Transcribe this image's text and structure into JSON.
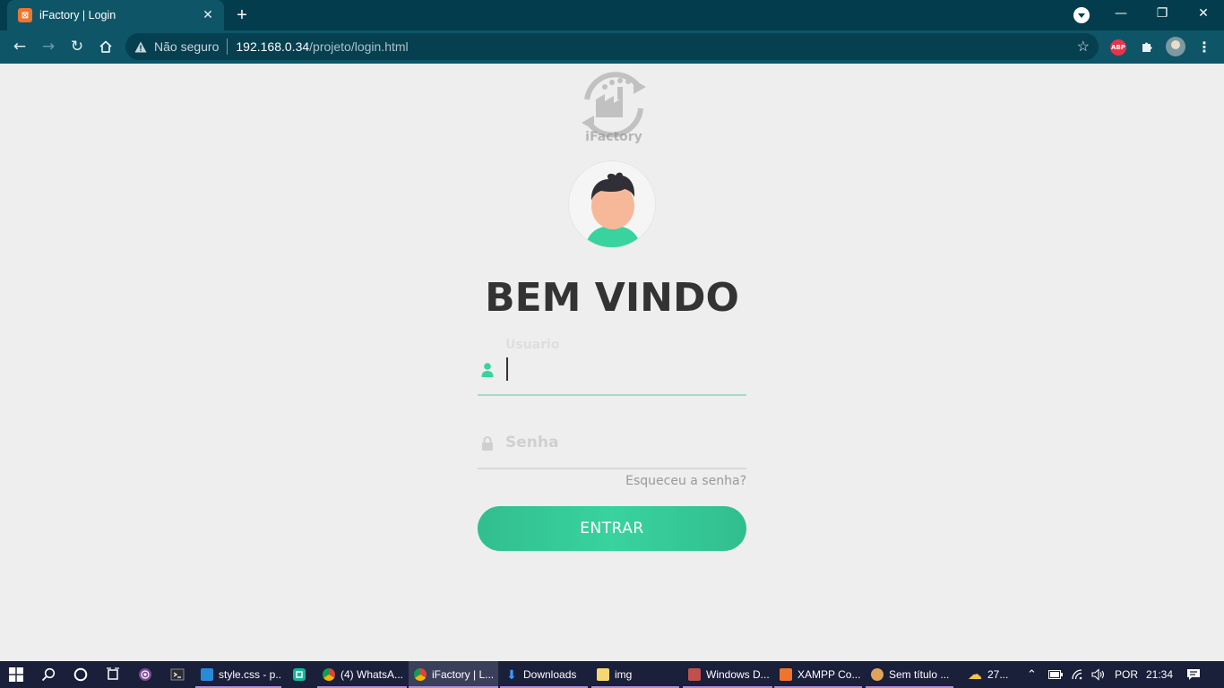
{
  "browser": {
    "tab": {
      "title": "iFactory | Login",
      "favicon": "xampp-icon"
    },
    "address_bar": {
      "security_text": "Não seguro",
      "url_host": "192.168.0.34",
      "url_path": "/projeto/login.html"
    },
    "extensions": {
      "abp_label": "ABP"
    }
  },
  "page": {
    "logo_text": "iFactory",
    "heading": "BEM VINDO",
    "username": {
      "label": "Usuario",
      "value": ""
    },
    "password": {
      "label": "Senha",
      "value": ""
    },
    "forgot_link": "Esqueceu a senha?",
    "submit_label": "ENTRAR",
    "colors": {
      "accent": "#38d39f",
      "heading": "#333333",
      "background": "#eeeeee"
    }
  },
  "taskbar": {
    "apps": [
      {
        "label": "style.css - p...",
        "icon": "vscode-icon"
      },
      {
        "label": "(4) WhatsA...",
        "icon": "chrome-icon"
      },
      {
        "label": "iFactory | L...",
        "icon": "chrome-icon",
        "active": true
      },
      {
        "label": "Downloads",
        "icon": "download-folder-icon"
      },
      {
        "label": "img",
        "icon": "folder-icon"
      },
      {
        "label": "Windows D...",
        "icon": "windows-defender-icon"
      },
      {
        "label": "XAMPP Co...",
        "icon": "xampp-icon"
      },
      {
        "label": "Sem título ...",
        "icon": "paint-icon"
      }
    ],
    "weather": "27...",
    "language": "POR",
    "time": "21:34"
  }
}
